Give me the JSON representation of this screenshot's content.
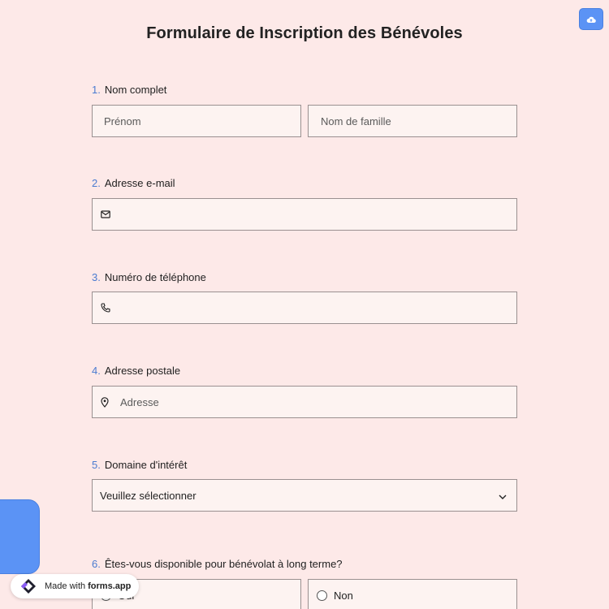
{
  "form": {
    "title": "Formulaire de Inscription des Bénévoles"
  },
  "questions": [
    {
      "number": "1.",
      "label": "Nom complet"
    },
    {
      "number": "2.",
      "label": "Adresse e-mail"
    },
    {
      "number": "3.",
      "label": "Numéro de téléphone"
    },
    {
      "number": "4.",
      "label": "Adresse postale"
    },
    {
      "number": "5.",
      "label": "Domaine d'intérêt"
    },
    {
      "number": "6.",
      "label": "Êtes-vous disponible pour bénévolat à long terme?"
    }
  ],
  "fields": {
    "first_name_placeholder": "Prénom",
    "last_name_placeholder": "Nom de famille",
    "email_icon": "mail-icon",
    "phone_icon": "phone-icon",
    "address_icon": "map-pin-icon",
    "address_placeholder": "Adresse",
    "interest_selected": "Veuillez sélectionner",
    "availability_options": [
      "Oui",
      "Non"
    ]
  },
  "badge": {
    "prefix": "Made with",
    "brand": "forms.app"
  },
  "colors": {
    "background": "#fde9e8",
    "accent": "#5b93f5",
    "question_number": "#4a7bd0"
  }
}
